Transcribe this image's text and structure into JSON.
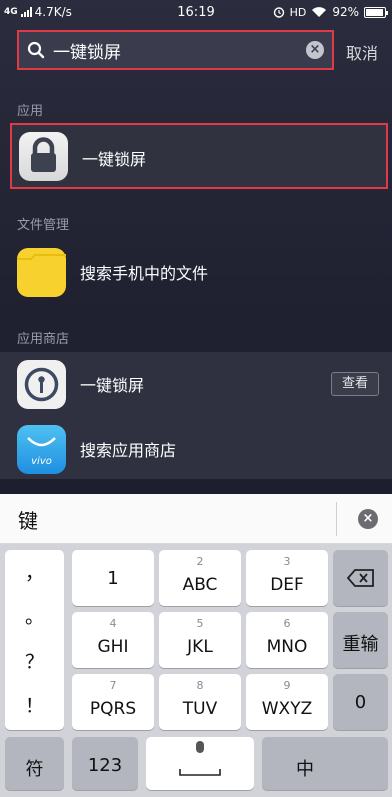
{
  "status_bar": {
    "network": "4G",
    "speed": "4.7K/s",
    "time": "16:19",
    "hd": "HD",
    "battery": "92%",
    "battery_level": 0.92
  },
  "search": {
    "value": "一键锁屏",
    "cancel_label": "取消"
  },
  "sections": {
    "apps": {
      "title": "应用",
      "item_label": "一键锁屏"
    },
    "files": {
      "title": "文件管理",
      "item_label": "搜索手机中的文件"
    },
    "store": {
      "title": "应用商店",
      "item_label": "一键锁屏",
      "view_label": "查看",
      "search_label": "搜索应用商店",
      "vivo_text": "vivo"
    }
  },
  "candidate": {
    "char": "键"
  },
  "keyboard": {
    "punctuation": [
      "，",
      "。",
      "？",
      "！"
    ],
    "row1": [
      {
        "num": "",
        "letters": "1"
      },
      {
        "num": "2",
        "letters": "ABC"
      },
      {
        "num": "3",
        "letters": "DEF"
      }
    ],
    "row2": [
      {
        "num": "4",
        "letters": "GHI"
      },
      {
        "num": "5",
        "letters": "JKL"
      },
      {
        "num": "6",
        "letters": "MNO"
      }
    ],
    "row3": [
      {
        "num": "7",
        "letters": "PQRS"
      },
      {
        "num": "8",
        "letters": "TUV"
      },
      {
        "num": "9",
        "letters": "WXYZ"
      }
    ],
    "retype_label": "重输",
    "zero_label": "0",
    "symbol_label": "符",
    "num123_label": "123",
    "chinese_label": "中"
  }
}
